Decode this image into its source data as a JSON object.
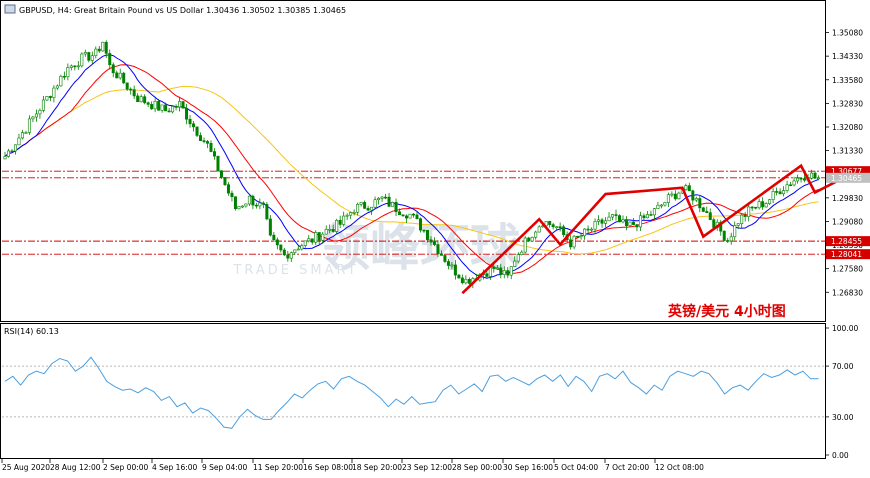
{
  "header": {
    "symbol": "GBPUSD",
    "timeframe": "H4",
    "description": "Great Britain Pound vs US Dollar",
    "ohlc": "1.30436 1.30502 1.30385 1.30465"
  },
  "rsi_label": "RSI(14) 60.13",
  "annotation": "英镑/美元  4小时图",
  "watermark": {
    "cn": "领峰环球",
    "en": "TRADE SMART"
  },
  "colors": {
    "candle": "#008000",
    "ma_fast": "#0000ff",
    "ma_mid": "#ff0000",
    "ma_slow": "#f5c518",
    "level_line": "#d40000",
    "arrow": "#e00000",
    "rsi": "#4a9fe0"
  },
  "chart_data": [
    {
      "type": "candlestick",
      "ylim": [
        1.2595,
        1.3605
      ],
      "y_ticks": [
        "1.35080",
        "1.34330",
        "1.33580",
        "1.32830",
        "1.32080",
        "1.31330",
        "1.30580",
        "1.29830",
        "1.29080",
        "1.28330",
        "1.27580",
        "1.26830"
      ],
      "x_ticks": [
        "25 Aug 2020",
        "28 Aug 12:00",
        "2 Sep 00:00",
        "4 Sep 16:00",
        "9 Sep 04:00",
        "11 Sep 20:00",
        "16 Sep 08:00",
        "18 Sep 20:00",
        "23 Sep 12:00",
        "28 Sep 00:00",
        "30 Sep 16:00",
        "5 Oct 04:00",
        "7 Oct 20:00",
        "12 Oct 08:00"
      ],
      "horizontal_levels": [
        {
          "label": "1.30677",
          "value": 1.30677
        },
        {
          "label": "1.30465",
          "value": 1.30465
        },
        {
          "label": "1.28455",
          "value": 1.28455
        },
        {
          "label": "1.28041",
          "value": 1.28041
        }
      ],
      "close_path": [
        [
          0,
          1.3115
        ],
        [
          6,
          1.3205
        ],
        [
          12,
          1.33
        ],
        [
          18,
          1.3395
        ],
        [
          22,
          1.3425
        ],
        [
          26,
          1.344
        ],
        [
          28,
          1.348
        ],
        [
          30,
          1.34
        ],
        [
          34,
          1.335
        ],
        [
          38,
          1.33
        ],
        [
          42,
          1.328
        ],
        [
          46,
          1.326
        ],
        [
          50,
          1.328
        ],
        [
          54,
          1.321
        ],
        [
          58,
          1.315
        ],
        [
          62,
          1.305
        ],
        [
          66,
          1.295
        ],
        [
          70,
          1.298
        ],
        [
          74,
          1.295
        ],
        [
          76,
          1.285
        ],
        [
          80,
          1.28
        ],
        [
          84,
          1.283
        ],
        [
          88,
          1.285
        ],
        [
          92,
          1.288
        ],
        [
          96,
          1.29
        ],
        [
          100,
          1.295
        ],
        [
          104,
          1.296
        ],
        [
          108,
          1.298
        ],
        [
          112,
          1.295
        ],
        [
          116,
          1.293
        ],
        [
          120,
          1.288
        ],
        [
          124,
          1.282
        ],
        [
          128,
          1.276
        ],
        [
          132,
          1.272
        ],
        [
          136,
          1.274
        ],
        [
          140,
          1.276
        ],
        [
          144,
          1.273
        ],
        [
          146,
          1.279
        ],
        [
          150,
          1.286
        ],
        [
          154,
          1.291
        ],
        [
          158,
          1.289
        ],
        [
          162,
          1.284
        ],
        [
          166,
          1.287
        ],
        [
          170,
          1.29
        ],
        [
          174,
          1.292
        ],
        [
          178,
          1.289
        ],
        [
          182,
          1.291
        ],
        [
          186,
          1.294
        ],
        [
          190,
          1.298
        ],
        [
          194,
          1.301
        ],
        [
          196,
          1.3
        ],
        [
          200,
          1.295
        ],
        [
          204,
          1.289
        ],
        [
          207,
          1.285
        ],
        [
          210,
          1.291
        ],
        [
          214,
          1.295
        ],
        [
          218,
          1.297
        ],
        [
          222,
          1.301
        ],
        [
          226,
          1.304
        ],
        [
          230,
          1.306
        ],
        [
          232,
          1.3047
        ]
      ],
      "drawn_arrow": [
        [
          "23 Sep",
          1.268
        ],
        [
          "28 Sep",
          1.2915
        ],
        [
          "29 Sep",
          1.2835
        ],
        [
          "1 Oct",
          1.2995
        ],
        [
          "5 Oct",
          1.3015
        ],
        [
          "6 Oct",
          1.286
        ],
        [
          "12 Oct",
          1.3085
        ],
        [
          "12 Oct",
          1.3
        ],
        [
          "13 Oct",
          1.308
        ]
      ]
    },
    {
      "type": "line",
      "name": "RSI(14)",
      "ylim": [
        0,
        100
      ],
      "y_ticks": [
        "100.00",
        "70.00",
        "30.00",
        "0.00"
      ],
      "levels": [
        70,
        30
      ],
      "values": [
        58,
        62,
        55,
        63,
        66,
        64,
        72,
        76,
        74,
        66,
        70,
        77,
        68,
        58,
        54,
        51,
        52,
        49,
        53,
        50,
        43,
        46,
        38,
        41,
        33,
        37,
        35,
        29,
        22,
        21,
        30,
        36,
        31,
        28,
        28,
        35,
        41,
        48,
        45,
        51,
        56,
        58,
        52,
        60,
        62,
        58,
        55,
        50,
        45,
        38,
        44,
        40,
        46,
        40,
        41,
        42,
        51,
        55,
        48,
        52,
        56,
        50,
        62,
        63,
        58,
        61,
        58,
        55,
        60,
        63,
        58,
        63,
        54,
        62,
        58,
        50,
        62,
        64,
        60,
        66,
        57,
        53,
        48,
        55,
        51,
        62,
        66,
        64,
        62,
        66,
        64,
        57,
        48,
        53,
        55,
        51,
        58,
        64,
        61,
        63,
        67,
        63,
        66,
        60,
        60
      ]
    }
  ]
}
